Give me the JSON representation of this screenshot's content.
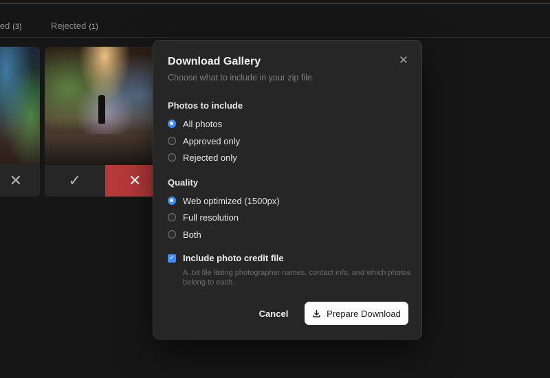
{
  "tabs": [
    {
      "label": "oved",
      "count": "(3)"
    },
    {
      "label": "Rejected",
      "count": "(1)"
    }
  ],
  "cards": {
    "card1_actions": [
      "close-icon"
    ],
    "card2_actions": [
      "check-icon",
      "close-icon"
    ]
  },
  "modal": {
    "title": "Download Gallery",
    "subtitle": "Choose what to include in your zip file.",
    "close_icon": "close-icon",
    "photos_section": {
      "label": "Photos to include",
      "options": [
        {
          "label": "All photos",
          "checked": true
        },
        {
          "label": "Approved only",
          "checked": false
        },
        {
          "label": "Rejected only",
          "checked": false
        }
      ]
    },
    "quality_section": {
      "label": "Quality",
      "options": [
        {
          "label": "Web optimized (1500px)",
          "checked": true
        },
        {
          "label": "Full resolution",
          "checked": false
        },
        {
          "label": "Both",
          "checked": false
        }
      ]
    },
    "credit_checkbox": {
      "label": "Include photo credit file",
      "checked": true,
      "help": "A .txt file listing photographer names, contact info, and which photos belong to each."
    },
    "cancel_label": "Cancel",
    "prepare_label": "Prepare Download",
    "prepare_icon": "download-icon"
  },
  "colors": {
    "accent": "#3f8cff",
    "reject_active": "#b7393a",
    "background": "#161616",
    "modal": "#262626"
  }
}
